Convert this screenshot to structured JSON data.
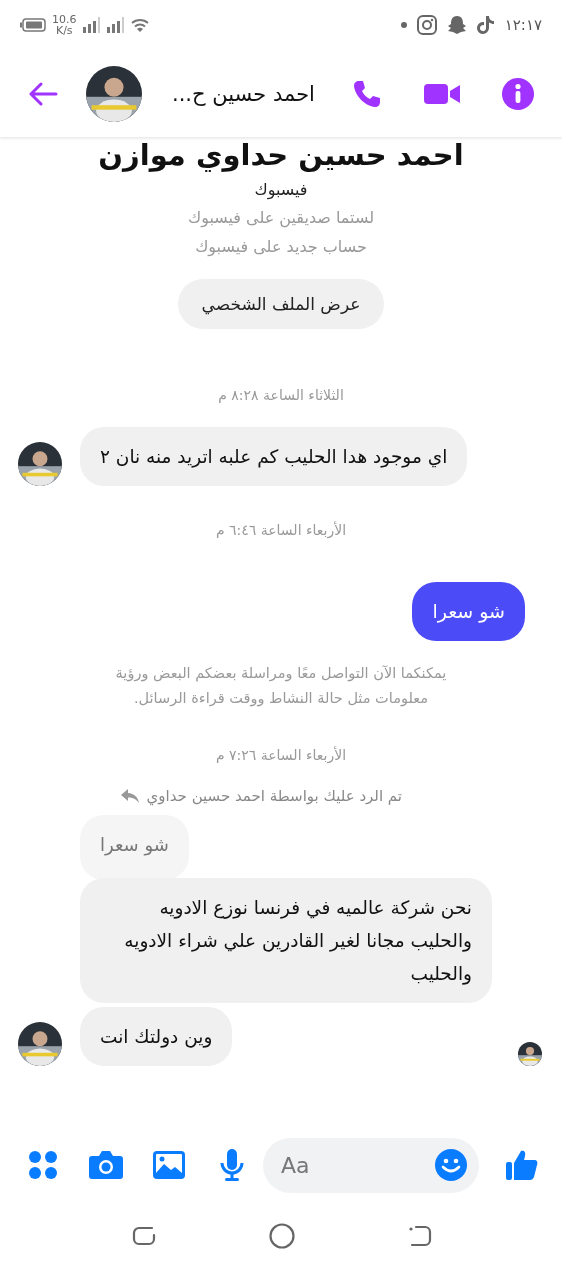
{
  "status_bar": {
    "speed": "10.6",
    "speed_unit": "K/s",
    "time": "١٢:١٧"
  },
  "header": {
    "name": "احمد حسين ح..."
  },
  "profile": {
    "name": "احمد حسين حداوي موازن",
    "source": "فيسبوك",
    "lines": [
      "لستما صديقين على فيسبوك",
      "حساب جديد على فيسبوك"
    ],
    "button": "عرض الملف الشخصي"
  },
  "messages": [
    {
      "kind": "timestamp",
      "text": "الثلاثاء الساعة ٨:٢٨ م"
    },
    {
      "kind": "incoming",
      "text": "اي موجود هدا الحليب كم علبه اتريد منه نان ٢",
      "avatar": true,
      "seen": false
    },
    {
      "kind": "timestamp",
      "text": "الأربعاء الساعة ٦:٤٦ م"
    },
    {
      "kind": "outgoing",
      "text": "شو سعرا"
    },
    {
      "kind": "notice",
      "text": "يمكنكما الآن التواصل معًا ومراسلة بعضكم البعض ورؤية معلومات مثل حالة النشاط ووقت قراءة الرسائل."
    },
    {
      "kind": "timestamp",
      "text": "الأربعاء الساعة ٧:٢٦ م"
    },
    {
      "kind": "reply_label",
      "text": "تم الرد عليك بواسطة احمد حسين حداوي"
    },
    {
      "kind": "quote",
      "text": "شو سعرا"
    },
    {
      "kind": "incoming",
      "text": "نحن شركة عالميه في فرنسا نوزع الادويه والحليب مجانا لغير القادرين علي شراء الادويه والحليب",
      "avatar": false,
      "seen": false
    },
    {
      "kind": "incoming",
      "text": "وين دولتك انت",
      "avatar": true,
      "seen": true
    }
  ],
  "composer": {
    "placeholder": "Aa"
  }
}
